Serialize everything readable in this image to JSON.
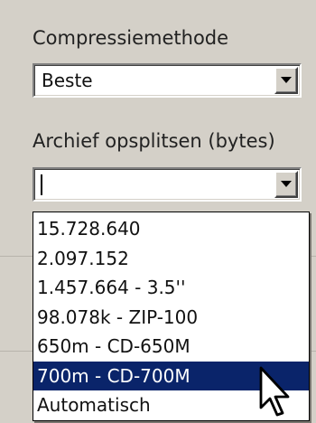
{
  "compression": {
    "label": "Compressiemethode",
    "selected_value": "Beste",
    "dropdown_icon": "chevron-down-icon"
  },
  "split": {
    "label": "Archief opsplitsen (bytes)",
    "current_value": "",
    "dropdown_icon": "chevron-down-icon",
    "options": [
      "15.728.640",
      "2.097.152",
      "1.457.664 - 3.5''",
      "98.078k - ZIP-100",
      "650m - CD-650M",
      "700m - CD-700M",
      "Automatisch"
    ],
    "highlighted_option": "700m - CD-700M"
  },
  "colors": {
    "highlight": "#0a246a",
    "window_bg": "#d4d0c8"
  },
  "cursor_icon": "arrow-pointer-icon"
}
